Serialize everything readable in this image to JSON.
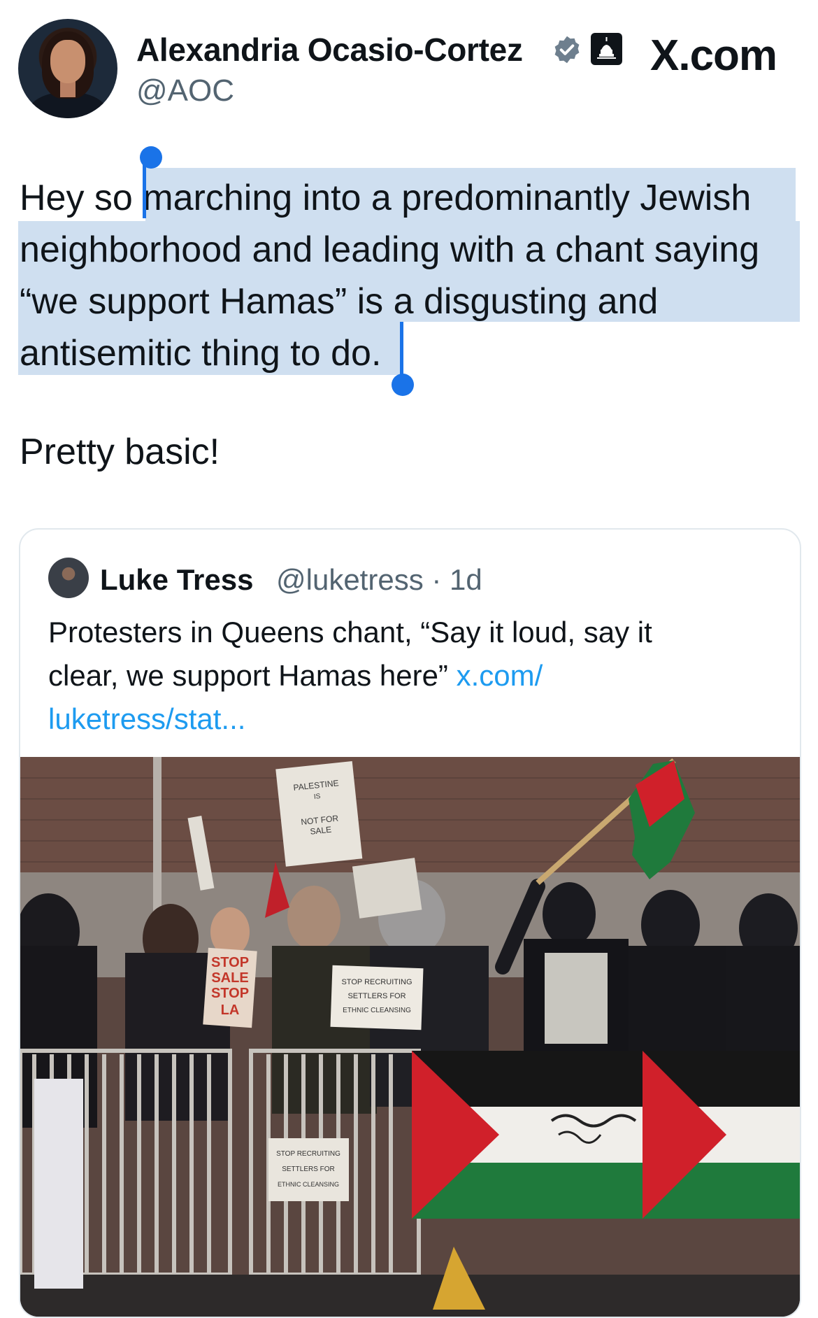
{
  "author": {
    "name": "Alexandria Ocasio-Cortez",
    "handle": "@AOC"
  },
  "brand": "X.com",
  "tweet": {
    "text_lines": [
      "Hey so marching into a predominantly Jewish",
      "neighborhood and leading with a chant saying",
      "“we support Hamas” is a disgusting and",
      "antisemitic thing to do."
    ],
    "second_paragraph": "Pretty basic!"
  },
  "quoted": {
    "name": "Luke Tress",
    "handle_time": "@luketress · 1d",
    "text_line1": "Protesters in Queens chant, “Say it loud, say it",
    "text_line2_plain": "clear, we support Hamas here” ",
    "text_line2_link": "x.com/",
    "text_line3_link": "luketress/stat..."
  },
  "photo_signs": {
    "sign1_l1": "PALESTINE",
    "sign1_l2": "IS",
    "sign1_l3": "NOT FOR",
    "sign1_l4": "SALE",
    "sign2_l1": "STOP RECRUITING",
    "sign2_l2": "SETTLERS FOR",
    "sign2_l3": "ETHNIC CLEANSING",
    "sign3_l1": "STOP RECRUITING",
    "sign3_l2": "SETTLERS FOR",
    "sign3_l3": "ETHNIC CLEANSING",
    "sign4_l1": "STOP",
    "sign4_l2": "SALE",
    "sign4_l3": "STOP",
    "sign4_l4": "LA"
  },
  "colors": {
    "selection_highlight": "#cfdff0",
    "selection_handle": "#1a73e8",
    "link": "#1d9bf0",
    "flag_red": "#d0202a",
    "flag_green": "#1f7a3c"
  }
}
